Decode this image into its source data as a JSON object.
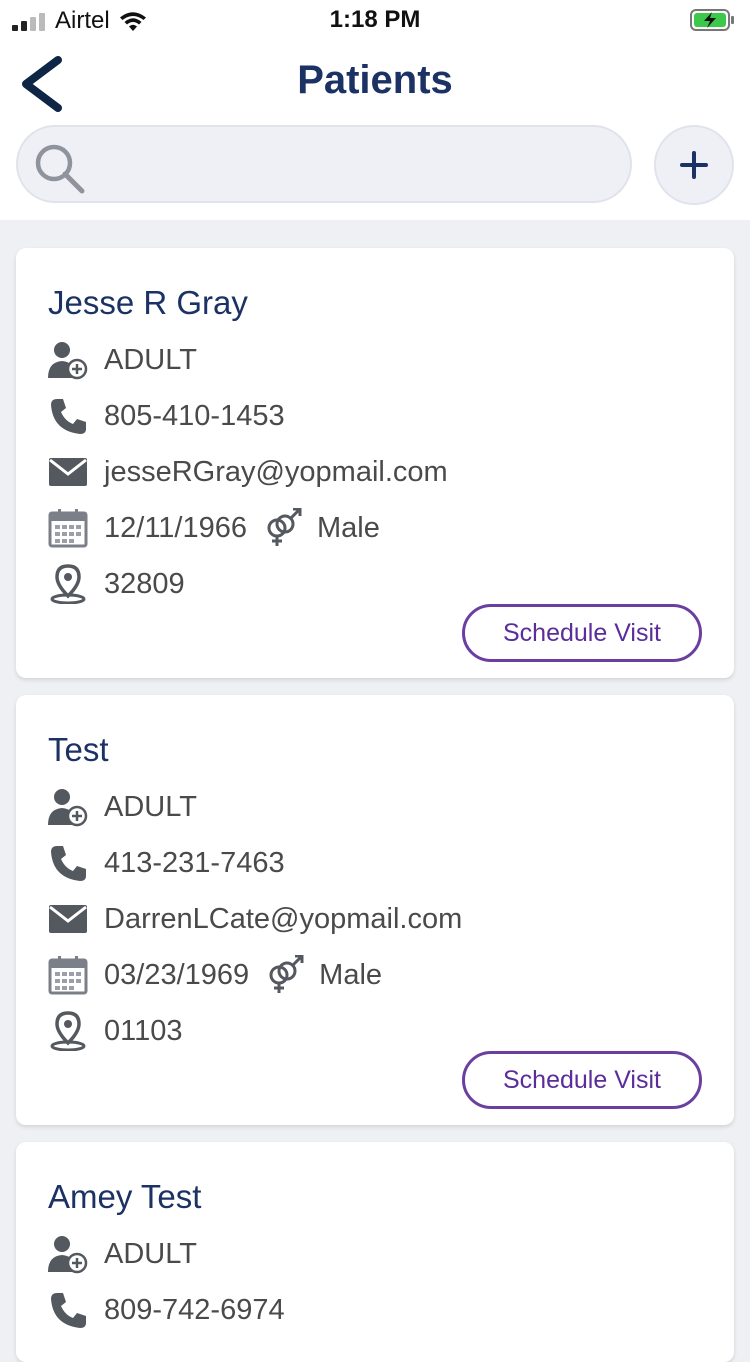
{
  "status": {
    "carrier": "Airtel",
    "time": "1:18 PM"
  },
  "header": {
    "title": "Patients"
  },
  "search": {
    "placeholder": ""
  },
  "patients": [
    {
      "name": "Jesse R Gray",
      "type": "ADULT",
      "phone": "805-410-1453",
      "email": "jesseRGray@yopmail.com",
      "dob": "12/11/1966",
      "gender": "Male",
      "zip": "32809",
      "action_label": "Schedule Visit"
    },
    {
      "name": "Test",
      "type": "ADULT",
      "phone": "413-231-7463",
      "email": "DarrenLCate@yopmail.com",
      "dob": "03/23/1969",
      "gender": "Male",
      "zip": "01103",
      "action_label": "Schedule Visit"
    },
    {
      "name": "Amey Test",
      "type": "ADULT",
      "phone": "809-742-6974"
    }
  ],
  "colors": {
    "brand_navy": "#1c3265",
    "accent_purple": "#6b3fa0",
    "icon_gray": "#54585f"
  },
  "icons": {
    "back": "chevron-left-icon",
    "search": "search-icon",
    "add": "plus-icon",
    "patient_type": "patient-icon",
    "phone": "phone-icon",
    "email": "mail-icon",
    "dob": "calendar-icon",
    "gender": "gender-icon",
    "zip": "location-pin-icon"
  }
}
